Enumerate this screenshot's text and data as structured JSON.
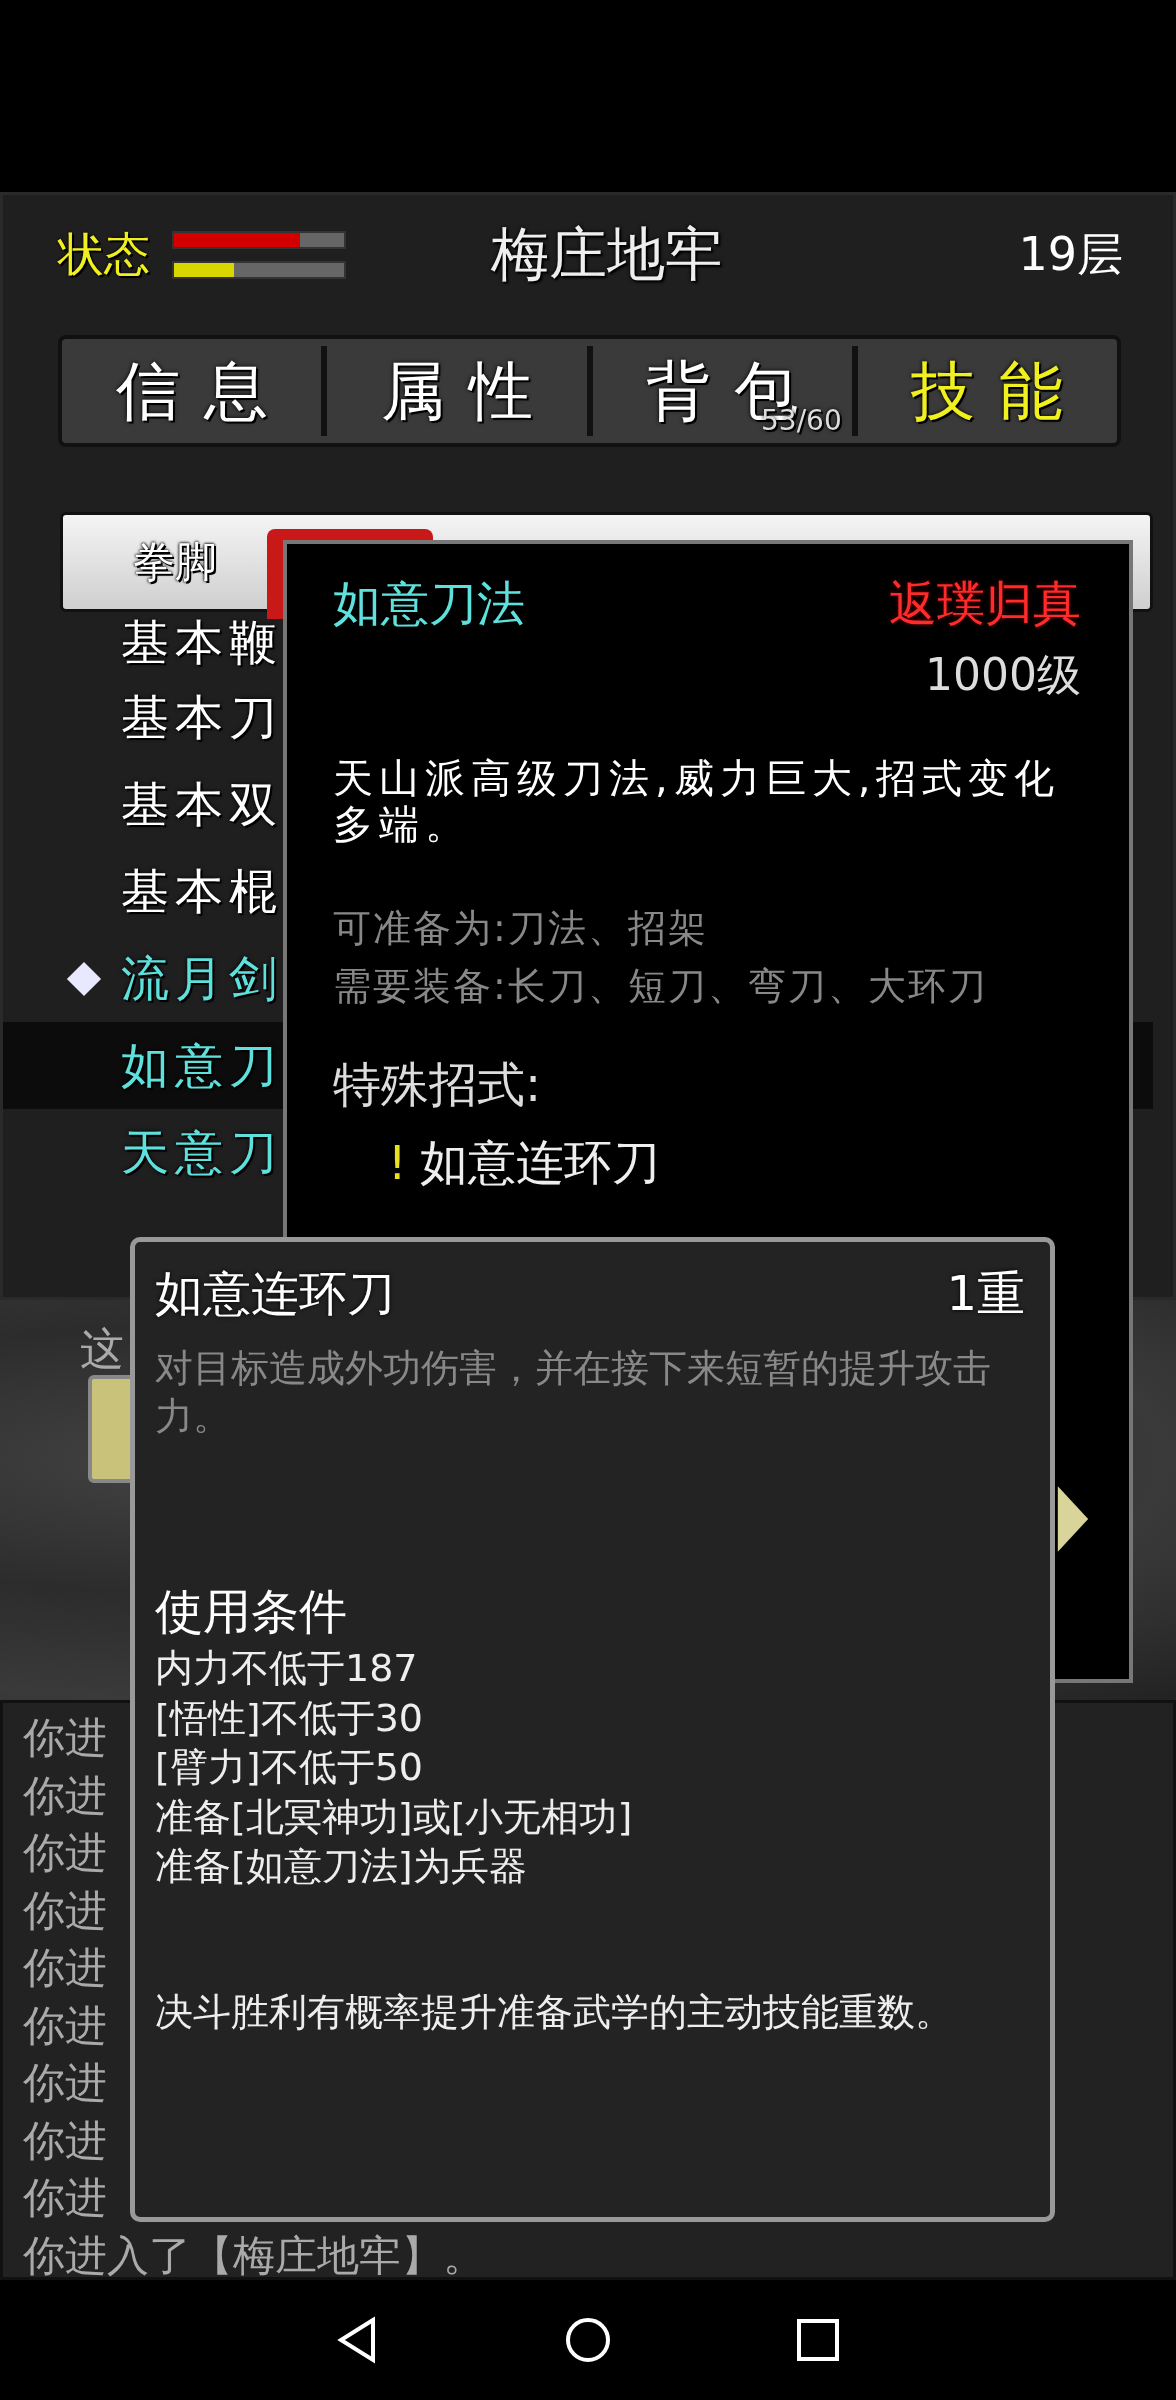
{
  "header": {
    "status_label": "状态",
    "bars": [
      {
        "color": "#d40000",
        "level": 0.74
      },
      {
        "color": "#d8d800",
        "level": 0.35
      }
    ],
    "title": "梅庄地牢",
    "floor": "19层"
  },
  "tabs": [
    {
      "label": "信息",
      "selected": false
    },
    {
      "label": "属性",
      "selected": false
    },
    {
      "label": "背包",
      "selected": false,
      "badge": "53/60"
    },
    {
      "label": "技能",
      "selected": true
    }
  ],
  "category_tabs": [
    {
      "label": "拳脚",
      "selected": false
    },
    {
      "selected": true
    }
  ],
  "skills": [
    {
      "name": "基本鞭",
      "color": "#ffffff",
      "marked": false,
      "selected": false
    },
    {
      "name": "基本刀",
      "color": "#ffffff",
      "marked": false,
      "selected": false
    },
    {
      "name": "基本双",
      "color": "#ffffff",
      "marked": false,
      "selected": false
    },
    {
      "name": "基本棍",
      "color": "#ffffff",
      "marked": false,
      "selected": false
    },
    {
      "name": "流月剑",
      "color": "#5ee0dc",
      "marked": true,
      "selected": false
    },
    {
      "name": "如意刀",
      "color": "#5ee0dc",
      "marked": false,
      "selected": true
    },
    {
      "name": "天意刀",
      "color": "#5ee0dc",
      "marked": false,
      "selected": false
    }
  ],
  "prompt_text": "这",
  "log": [
    "你进",
    "你进",
    "你进",
    "你进",
    "你进",
    "你进",
    "你进",
    "你进",
    "你进",
    "你进入了【梅庄地牢】。"
  ],
  "skill_detail": {
    "name": "如意刀法",
    "realm": "返璞归真",
    "level": "1000级",
    "description": "天山派高级刀法,威力巨大,招式变化多端。",
    "info_lines": [
      "可准备为:刀法、招架",
      "需要装备:长刀、短刀、弯刀、大环刀"
    ],
    "special_label": "特殊招式:",
    "special_moves": [
      {
        "mark": "!",
        "name": "如意连环刀"
      }
    ]
  },
  "move_tooltip": {
    "name": "如意连环刀",
    "tier": "1重",
    "description": "对目标造成外功伤害，并在接下来短暂的提升攻击力。",
    "conditions_title": "使用条件",
    "conditions": [
      "内力不低于187",
      "[悟性]不低于30",
      "[臂力]不低于50",
      "准备[北冥神功]或[小无相功]",
      "准备[如意刀法]为兵器"
    ],
    "note": "决斗胜利有概率提升准备武学的主动技能重数。"
  }
}
